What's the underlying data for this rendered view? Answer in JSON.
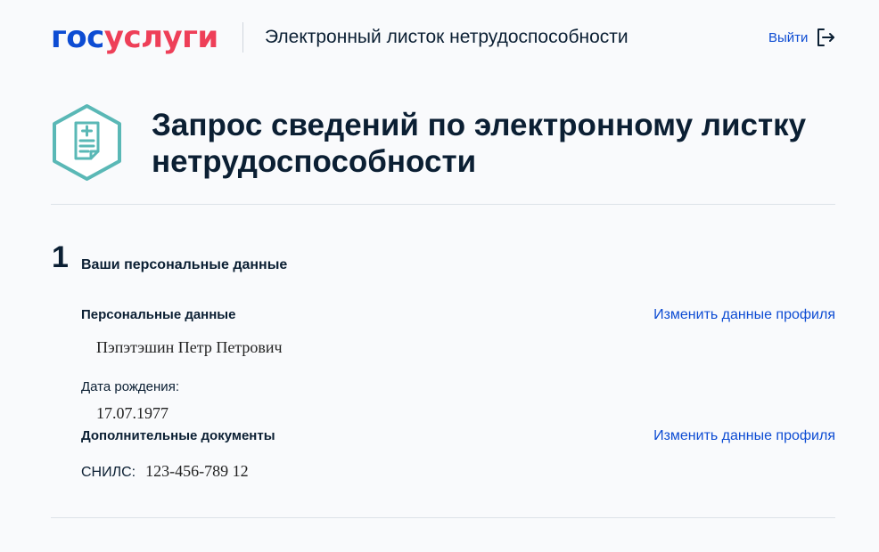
{
  "header": {
    "logo_part1": "гос",
    "logo_part2": "услуги",
    "service_title": "Электронный листок нетрудоспособности",
    "logout_label": "Выйти"
  },
  "page": {
    "title": "Запрос сведений по электронному листку нетрудоспособности",
    "icon": "document-icon"
  },
  "step": {
    "number": "1",
    "title": "Ваши персональные данные"
  },
  "personal": {
    "section_label": "Персональные данные",
    "edit_link": "Изменить данные профиля",
    "full_name": "Пэпэтэшин Петр Петрович",
    "birth_label": "Дата рождения:",
    "birth_date": "17.07.1977"
  },
  "documents": {
    "section_label": "Дополнительные документы",
    "edit_link": "Изменить данные профиля",
    "snils_label": "СНИЛС:",
    "snils_value": "123-456-789 12"
  },
  "colors": {
    "brand_blue": "#0d4cd3",
    "brand_red": "#ee3f58",
    "icon_teal": "#5ab8b6",
    "background": "#f9fafc"
  }
}
